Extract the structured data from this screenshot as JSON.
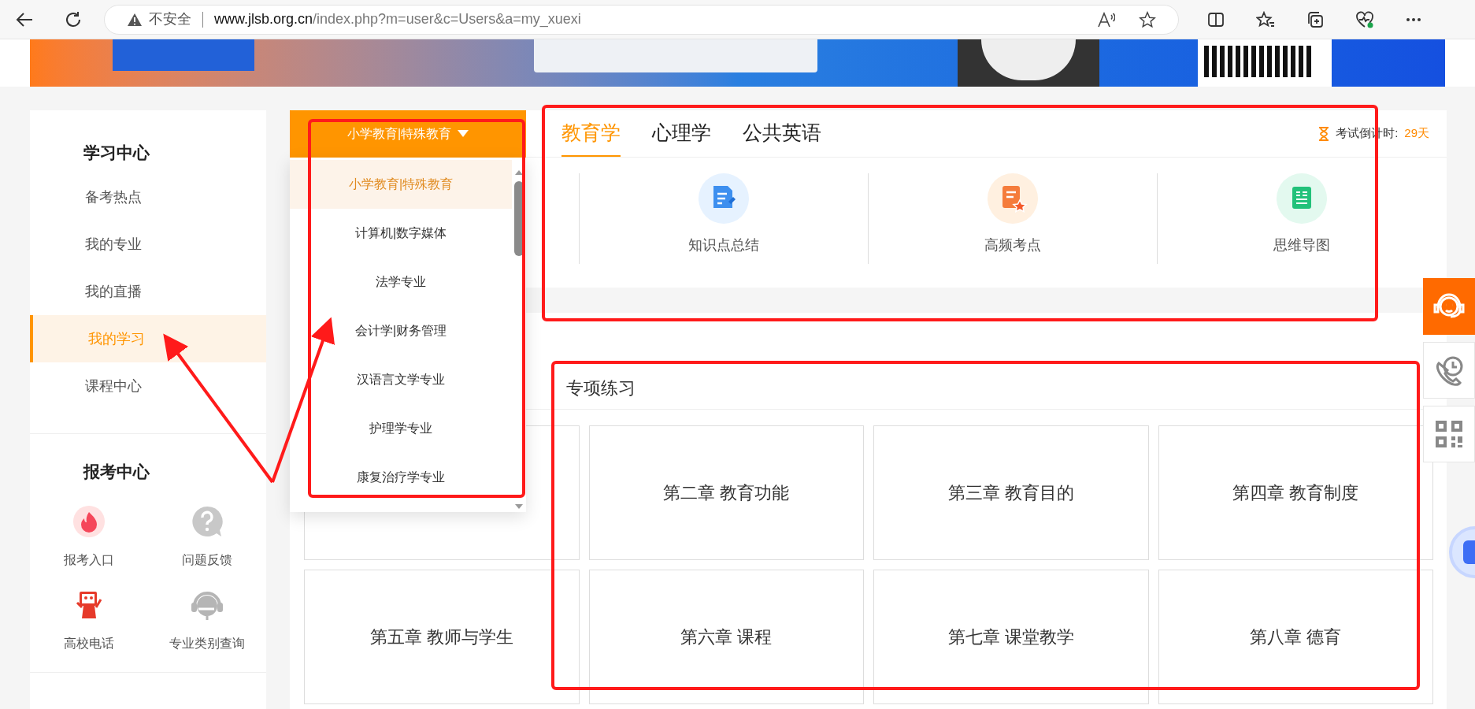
{
  "browser": {
    "security_label": "不安全",
    "url_host": "www.jlsb.org.cn",
    "url_path": "/index.php?m=user&c=Users&a=my_xuexi"
  },
  "sidebar": {
    "study_center": {
      "title": "学习中心",
      "items": [
        {
          "label": "备考热点",
          "selected": false
        },
        {
          "label": "我的专业",
          "selected": false
        },
        {
          "label": "我的直播",
          "selected": false
        },
        {
          "label": "我的学习",
          "selected": true
        },
        {
          "label": "课程中心",
          "selected": false
        }
      ]
    },
    "exam_center": {
      "title": "报考中心",
      "links": [
        {
          "label": "报考入口",
          "kind": "fire"
        },
        {
          "label": "问题反馈",
          "kind": "question"
        },
        {
          "label": "高校电话",
          "kind": "mascot"
        },
        {
          "label": "专业类别查询",
          "kind": "headset"
        }
      ]
    }
  },
  "major_dropdown": {
    "current": "小学教育|特殊教育",
    "expanded": true,
    "options": [
      {
        "label": "小学教育|特殊教育",
        "selected": true
      },
      {
        "label": "计算机|数字媒体",
        "selected": false
      },
      {
        "label": "法学专业",
        "selected": false
      },
      {
        "label": "会计学|财务管理",
        "selected": false
      },
      {
        "label": "汉语言文学专业",
        "selected": false
      },
      {
        "label": "护理学专业",
        "selected": false
      },
      {
        "label": "康复治疗学专业",
        "selected": false
      }
    ]
  },
  "subject_tabs": [
    {
      "label": "教育学",
      "selected": true
    },
    {
      "label": "心理学",
      "selected": false
    },
    {
      "label": "公共英语",
      "selected": false
    }
  ],
  "countdown": {
    "label": "考试倒计时:",
    "value": "29天"
  },
  "resources": [
    {
      "label": "知识点总结",
      "kind": "notes"
    },
    {
      "label": "高频考点",
      "kind": "star"
    },
    {
      "label": "思维导图",
      "kind": "mindmap"
    }
  ],
  "practice": {
    "title": "专项练习",
    "chapters": [
      "第二章 教育功能",
      "第三章 教育目的",
      "第四章 教育制度",
      "第五章 教师与学生",
      "第六章 课程",
      "第七章 课堂教学",
      "第八章 德育"
    ]
  }
}
